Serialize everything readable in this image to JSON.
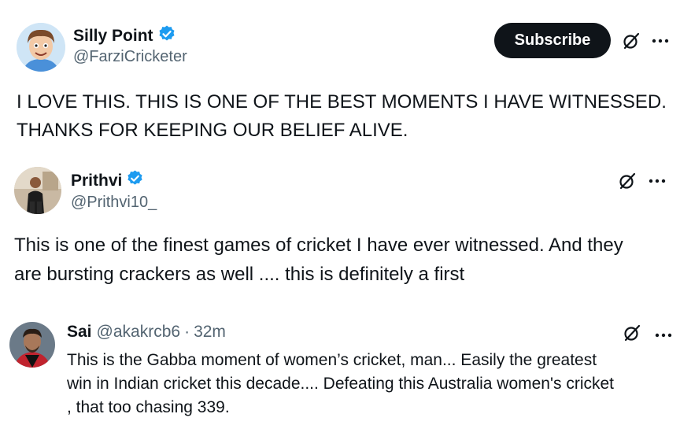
{
  "tweets": [
    {
      "name": "Silly Point",
      "handle": "@FarziCricketer",
      "subscribe_label": "Subscribe",
      "text": "I LOVE THIS. THIS IS ONE OF THE BEST MOMENTS I HAVE WITNESSED.\nTHANKS FOR KEEPING OUR BELIEF ALIVE.",
      "verified": true
    },
    {
      "name": "Prithvi",
      "handle": "@Prithvi10_",
      "text": "This is one of the finest games of cricket I have ever witnessed. And they\nare bursting crackers as well .... this is definitely a first",
      "verified": true
    },
    {
      "name": "Sai",
      "handle": "@akakrcb6",
      "separator": "·",
      "time": "32m",
      "text": "This is the Gabba moment of women’s cricket, man... Easily the greatest\nwin in Indian cricket this decade.... Defeating this Australia women's cricket\n, that too chasing 339.",
      "verified": false
    }
  ],
  "icons": {
    "verified": "verified-badge-icon",
    "grok": "grok-icon",
    "more": "more-icon"
  },
  "colors": {
    "verified_blue": "#1d9bf0",
    "text": "#0f1419",
    "secondary": "#536471",
    "button": "#0f1419"
  }
}
